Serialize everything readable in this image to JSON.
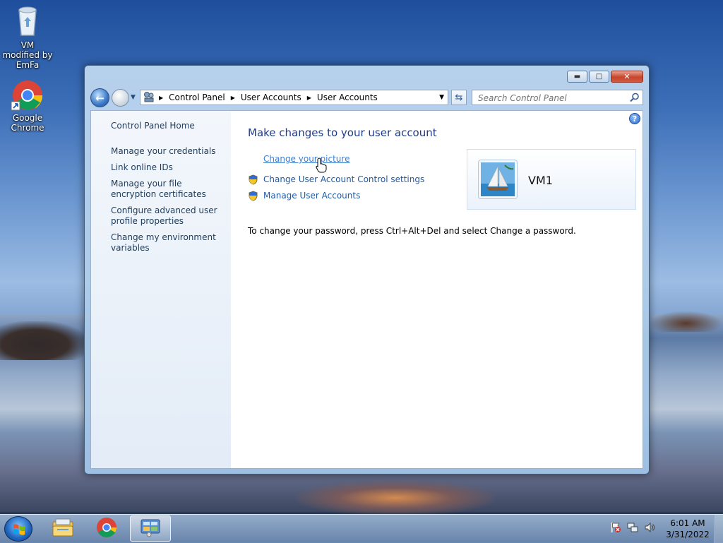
{
  "desktop": {
    "icons": [
      {
        "label": "VM modified by EmFa"
      },
      {
        "label": "Google Chrome"
      }
    ]
  },
  "window": {
    "address_crumbs": [
      "Control Panel",
      "User Accounts",
      "User Accounts"
    ],
    "search_placeholder": "Search Control Panel",
    "sidebar": {
      "home": "Control Panel Home",
      "links": [
        "Manage your credentials",
        "Link online IDs",
        "Manage your file encryption certificates",
        "Configure advanced user profile properties",
        "Change my environment variables"
      ]
    },
    "main": {
      "title": "Make changes to your user account",
      "tasks": [
        "Change your picture",
        "Change User Account Control settings",
        "Manage User Accounts"
      ],
      "user_name": "VM1",
      "password_note": "To change your password, press Ctrl+Alt+Del and select Change a password."
    },
    "help_label": "?"
  },
  "taskbar": {
    "clock_time": "6:01 AM",
    "clock_date": "3/31/2022",
    "pinned": [
      "windows-explorer-icon",
      "chrome-icon",
      "control-panel-icon"
    ]
  },
  "colors": {
    "link": "#1f5aa5",
    "link_hover": "#3b7fd1",
    "title": "#1e3b8a"
  }
}
